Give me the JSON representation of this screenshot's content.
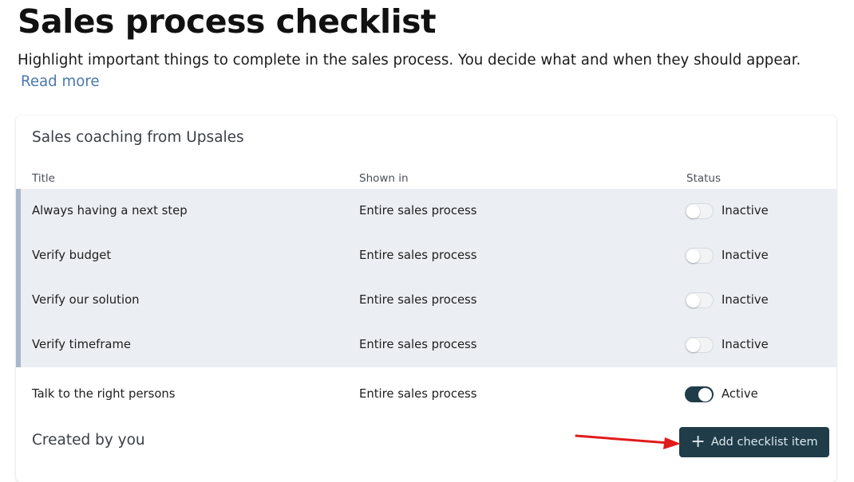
{
  "page": {
    "title": "Sales process checklist",
    "description": "Highlight important things to complete in the sales process. You decide what and when they should appear.",
    "read_more": "Read more"
  },
  "coaching": {
    "title": "Sales coaching from Upsales",
    "columns": {
      "title": "Title",
      "shown_in": "Shown in",
      "status": "Status"
    },
    "rows": [
      {
        "title": "Always having a next step",
        "shown_in": "Entire sales process",
        "status": "Inactive",
        "active": false
      },
      {
        "title": "Verify budget",
        "shown_in": "Entire sales process",
        "status": "Inactive",
        "active": false
      },
      {
        "title": "Verify our solution",
        "shown_in": "Entire sales process",
        "status": "Inactive",
        "active": false
      },
      {
        "title": "Verify timeframe",
        "shown_in": "Entire sales process",
        "status": "Inactive",
        "active": false
      },
      {
        "title": "Talk to the right persons",
        "shown_in": "Entire sales process",
        "status": "Active",
        "active": true
      }
    ]
  },
  "created": {
    "title": "Created by you",
    "add_button": {
      "icon": "plus-icon",
      "label": "Add checklist item"
    }
  },
  "colors": {
    "accent": "#1f3c48",
    "link": "#4a78b0",
    "inactive_row_bg": "#ebeef3",
    "inactive_row_marker": "#a9b7cc",
    "annotation_arrow": "#e01b1b"
  }
}
